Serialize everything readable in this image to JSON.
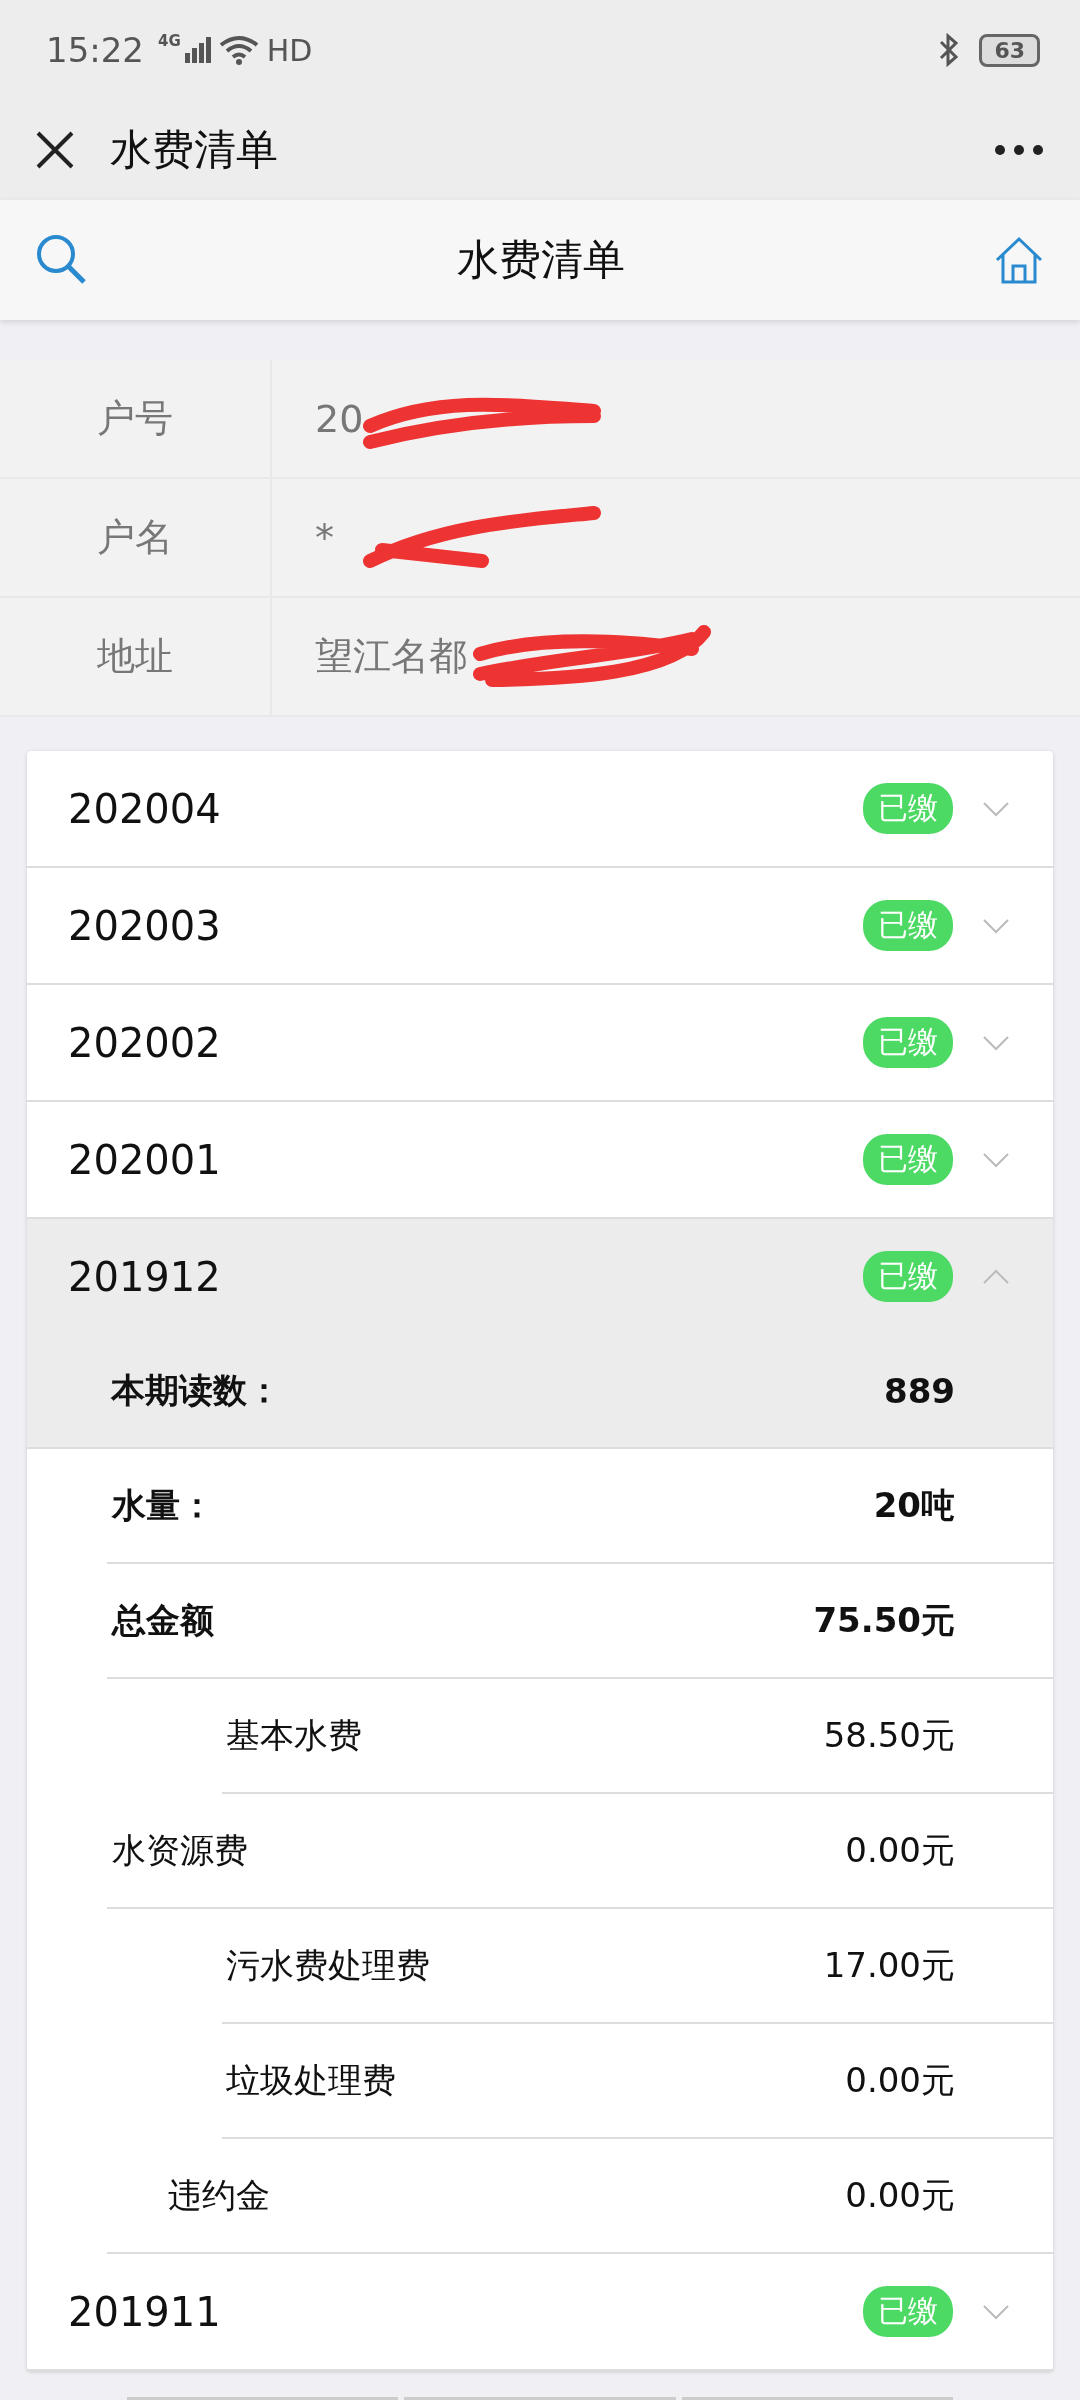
{
  "status_bar": {
    "time": "15:22",
    "network": "4G",
    "hd": "HD",
    "battery": "63"
  },
  "title_bar": {
    "title": "水费清单"
  },
  "header": {
    "title": "水费清单"
  },
  "account": [
    {
      "label": "户号",
      "value": "20",
      "redacted": true
    },
    {
      "label": "户名",
      "value": "*",
      "redacted": true
    },
    {
      "label": "地址",
      "value": "望江名都",
      "redacted": true
    }
  ],
  "bills": [
    {
      "month": "202004",
      "status": "已缴",
      "expanded": false
    },
    {
      "month": "202003",
      "status": "已缴",
      "expanded": false
    },
    {
      "month": "202002",
      "status": "已缴",
      "expanded": false
    },
    {
      "month": "202001",
      "status": "已缴",
      "expanded": false
    },
    {
      "month": "201912",
      "status": "已缴",
      "expanded": true,
      "details": [
        {
          "kind": "reading",
          "label": "本期读数：",
          "value": "889"
        },
        {
          "kind": "total",
          "label": "水量：",
          "value": "20吨"
        },
        {
          "kind": "total",
          "label": "总金额",
          "value": "75.50元"
        },
        {
          "kind": "sub",
          "label": "基本水费",
          "value": "58.50元"
        },
        {
          "kind": "item",
          "label": "水资源费",
          "value": "0.00元"
        },
        {
          "kind": "sub",
          "label": "污水费处理费",
          "value": "17.00元"
        },
        {
          "kind": "sub",
          "label": "垃圾处理费",
          "value": "0.00元"
        },
        {
          "kind": "mid",
          "label": "违约金",
          "value": "0.00元"
        }
      ]
    },
    {
      "month": "201911",
      "status": "已缴",
      "expanded": false
    }
  ]
}
